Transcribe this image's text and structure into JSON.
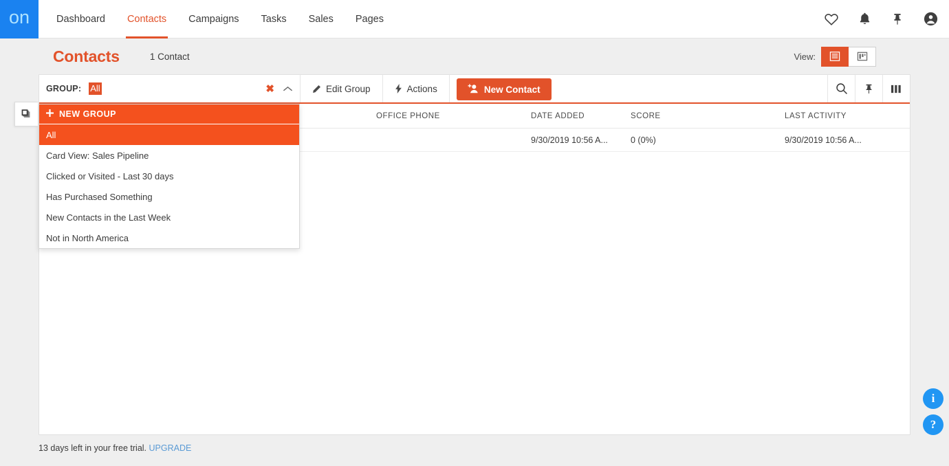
{
  "brand": {
    "logo_text": "on",
    "accent": "#e2522a",
    "accent_bright": "#f4511e",
    "logo_bg": "#1a82f0",
    "logo_fg": "#aee2ff",
    "link_blue": "#5b9bd5",
    "bubble_blue": "#2196f3"
  },
  "topnav": {
    "items": [
      {
        "label": "Dashboard",
        "active": false
      },
      {
        "label": "Contacts",
        "active": true
      },
      {
        "label": "Campaigns",
        "active": false
      },
      {
        "label": "Tasks",
        "active": false
      },
      {
        "label": "Sales",
        "active": false
      },
      {
        "label": "Pages",
        "active": false
      }
    ],
    "icons": [
      "heart-icon",
      "bell-icon",
      "pin-icon",
      "account-icon"
    ]
  },
  "header": {
    "title": "Contacts",
    "count": "1 Contact",
    "view_label": "View:",
    "view_options": [
      {
        "name": "list-view",
        "active": true
      },
      {
        "name": "card-view",
        "active": false
      }
    ]
  },
  "toolbar": {
    "group_label": "GROUP:",
    "group_value": "All",
    "group_placeholder": "All",
    "clear_glyph": "✖",
    "edit_group_label": "Edit Group",
    "actions_label": "Actions",
    "new_contact_label": "New Contact",
    "right_icons": [
      "search-icon",
      "pin-icon",
      "columns-icon"
    ]
  },
  "dropdown": {
    "new_group_label": "NEW GROUP",
    "items": [
      {
        "label": "All",
        "selected": true
      },
      {
        "label": "Card View: Sales Pipeline",
        "selected": false
      },
      {
        "label": "Clicked or Visited - Last 30 days",
        "selected": false
      },
      {
        "label": "Has Purchased Something",
        "selected": false
      },
      {
        "label": "New Contacts in the Last Week",
        "selected": false
      },
      {
        "label": "Not in North America",
        "selected": false
      }
    ]
  },
  "table": {
    "columns": [
      "",
      "",
      "OFFICE PHONE",
      "DATE ADDED",
      "SCORE",
      "LAST ACTIVITY"
    ],
    "headers": {
      "name": "",
      "email": "",
      "office_phone": "OFFICE PHONE",
      "date_added": "DATE ADDED",
      "score": "SCORE",
      "last_activity": "LAST ACTIVITY"
    },
    "rows": [
      {
        "name": "",
        "email": "",
        "office_phone": "",
        "date_added": "9/30/2019 10:56 A...",
        "score": "0 (0%)",
        "last_activity": "9/30/2019 10:56 A..."
      }
    ]
  },
  "footer": {
    "trial_text": "13 days left in your free trial.",
    "upgrade_label": "UPGRADE"
  },
  "bubbles": [
    {
      "name": "info-bubble",
      "glyph": "i"
    },
    {
      "name": "help-bubble",
      "glyph": "?"
    }
  ]
}
